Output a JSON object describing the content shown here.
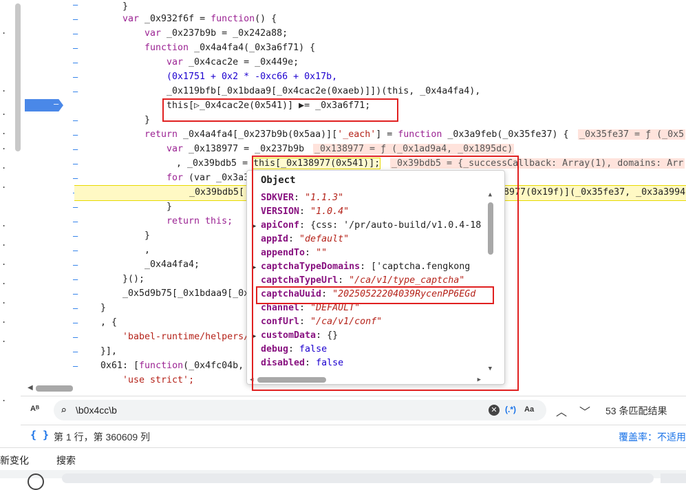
{
  "code_lines": [
    {
      "id": "l1",
      "text": "}"
    },
    {
      "id": "l2a",
      "text": "var "
    },
    {
      "id": "l2b",
      "text": "_0x932f6f = "
    },
    {
      "id": "l2c",
      "text": "function"
    },
    {
      "id": "l2d",
      "text": "() {"
    },
    {
      "id": "l3a",
      "text": "var "
    },
    {
      "id": "l3b",
      "text": "_0x237b9b = _0x242a88;"
    },
    {
      "id": "l4a",
      "text": "function "
    },
    {
      "id": "l4b",
      "text": "_0x4a4fa4(_0x3a6f71) {"
    },
    {
      "id": "l5a",
      "text": "var "
    },
    {
      "id": "l5b",
      "text": "_0x4cac2e = _0x449e;"
    },
    {
      "id": "l6",
      "text": "(0x1751 + 0x2 * -0xc66 + 0x17b,"
    },
    {
      "id": "l7",
      "text": "_0x119bfb[_0x1bdaa9[_0x4cac2e(0xaeb)]])(this, _0x4a4fa4),"
    },
    {
      "id": "l8",
      "text": "this[▷_0x4cac2e(0x541)] ▶= _0x3a6f71;"
    },
    {
      "id": "l9",
      "text": "}"
    },
    {
      "id": "l10a",
      "text": "return "
    },
    {
      "id": "l10b",
      "text": "_0x4a4fa4[_0x237b9b(0x5aa)]["
    },
    {
      "id": "l10c",
      "text": "'_each'"
    },
    {
      "id": "l10d",
      "text": "] = "
    },
    {
      "id": "l10e",
      "text": "function "
    },
    {
      "id": "l10f",
      "text": "_0x3a9feb(_0x35fe37) {"
    },
    {
      "id": "l10g",
      "text": "_0x35fe37 = ƒ (_0x5"
    },
    {
      "id": "l11a",
      "text": "var "
    },
    {
      "id": "l11b",
      "text": "_0x138977 = _0x237b9b"
    },
    {
      "id": "l11c",
      "text": "_0x138977 = ƒ (_0x1ad9a4, _0x1895dc)"
    },
    {
      "id": "l12a",
      "text": ", _0x39bdb5 = "
    },
    {
      "id": "l12b",
      "text": "this[_0x138977(0x541)];"
    },
    {
      "id": "l12c",
      "text": "_0x39bdb5 = {_successCallback: Array(1), domains: Arr"
    },
    {
      "id": "l13a",
      "text": "for "
    },
    {
      "id": "l13b",
      "text": "(var _0x3a3"
    },
    {
      "id": "l14a",
      "text": "_0x39bdb5["
    },
    {
      "id": "l14b",
      "text": "8977(0x19f)]("
    },
    {
      "id": "l14c",
      "text": "_0x35fe37, _0x3a3994,"
    },
    {
      "id": "l15",
      "text": "}"
    },
    {
      "id": "l16a",
      "text": "return "
    },
    {
      "id": "l16b",
      "text": "this;"
    },
    {
      "id": "l17",
      "text": "}"
    },
    {
      "id": "l18",
      "text": ","
    },
    {
      "id": "l19",
      "text": "_0x4a4fa4;"
    },
    {
      "id": "l20",
      "text": "}();"
    },
    {
      "id": "l21",
      "text": "_0x5d9b75[_0x1bdaa9[_0x"
    },
    {
      "id": "l22",
      "text": "}"
    },
    {
      "id": "l23",
      "text": ", {"
    },
    {
      "id": "l24",
      "text": "'babel-runtime/helpers/"
    },
    {
      "id": "l25",
      "text": "}],"
    },
    {
      "id": "l26a",
      "text": "0x61: ["
    },
    {
      "id": "l26b",
      "text": "function"
    },
    {
      "id": "l26c",
      "text": "(_0x4fc04b,"
    },
    {
      "id": "l27",
      "text": "'use strict';"
    }
  ],
  "popup": {
    "title": "Object",
    "props": [
      {
        "key": "SDKVER",
        "sep": ": ",
        "val": "\"1.1.3\"",
        "kind": "str"
      },
      {
        "key": "VERSION",
        "sep": ": ",
        "val": "\"1.0.4\"",
        "kind": "str"
      },
      {
        "key": "apiConf",
        "sep": ": ",
        "val": "{css: '/pr/auto-build/v1.0.4-18",
        "kind": "plain",
        "expandable": true
      },
      {
        "key": "appId",
        "sep": ": ",
        "val": "\"default\"",
        "kind": "str"
      },
      {
        "key": "appendTo",
        "sep": ": ",
        "val": "\"\"",
        "kind": "str"
      },
      {
        "key": "captchaTypeDomains",
        "sep": ": ",
        "val": "['captcha.fengkong",
        "kind": "plain",
        "expandable": true
      },
      {
        "key": "captchaTypeUrl",
        "sep": ": ",
        "val": "\"/ca/v1/type_captcha\"",
        "kind": "str"
      },
      {
        "key": "captchaUuid",
        "sep": ": ",
        "val": "\"20250522204039RycenPP6EGd",
        "kind": "str"
      },
      {
        "key": "channel",
        "sep": ": ",
        "val": "\"DEFAULT\"",
        "kind": "str"
      },
      {
        "key": "confUrl",
        "sep": ": ",
        "val": "\"/ca/v1/conf\"",
        "kind": "str"
      },
      {
        "key": "customData",
        "sep": ": ",
        "val": "{}",
        "kind": "plain",
        "expandable": true
      },
      {
        "key": "debug",
        "sep": ": ",
        "val": "false",
        "kind": "num"
      },
      {
        "key": "disabled",
        "sep": ": ",
        "val": "false",
        "kind": "num"
      }
    ]
  },
  "search": {
    "query": "\\b0x4cc\\b",
    "regex_label": "(.*)",
    "case_label": "Aa",
    "match_count": "53 条匹配结果",
    "case_sensitive_icon": "Aᴮ",
    "search_icon": "search-icon",
    "clear_icon": "clear-icon"
  },
  "status": {
    "position": "第 1 行，第 360609 列",
    "coverage": "覆盖率：不适用",
    "braces": "{ }"
  },
  "drawer_tabs": [
    "新变化",
    "搜索"
  ],
  "colors": {
    "accent": "#1a73e8",
    "highlight_red": "#e02020",
    "keyword": "#9b2393",
    "string": "#b5231a"
  }
}
